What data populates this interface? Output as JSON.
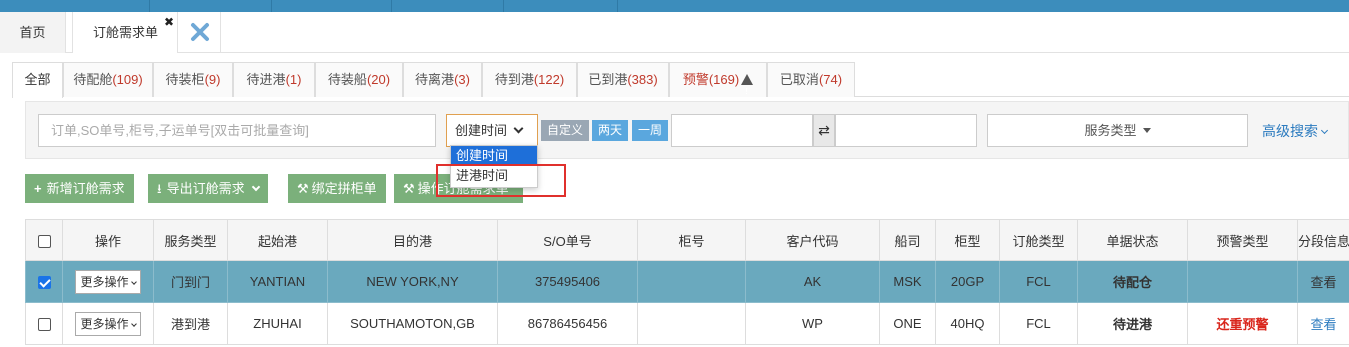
{
  "page_tabs": {
    "home": "首页",
    "order": "订舱需求单",
    "close_mark": "✖"
  },
  "status_tabs": [
    {
      "label": "全部",
      "count": ""
    },
    {
      "label": "待配舱",
      "count": "(109)"
    },
    {
      "label": "待装柜",
      "count": "(9)"
    },
    {
      "label": "待进港",
      "count": "(1)"
    },
    {
      "label": "待装船",
      "count": "(20)"
    },
    {
      "label": "待离港",
      "count": "(3)"
    },
    {
      "label": "待到港",
      "count": "(122)"
    },
    {
      "label": "已到港",
      "count": "(383)"
    },
    {
      "label": "预警",
      "count": "(169)"
    },
    {
      "label": "已取消",
      "count": "(74)"
    }
  ],
  "search": {
    "placeholder": "订单,SO单号,柜号,子运单号[双击可批量查询]",
    "date_type_selected": "创建时间",
    "quick_custom": "自定义",
    "quick_two_days": "两天",
    "quick_week": "一周",
    "service_type": "服务类型",
    "advanced": "高级搜索"
  },
  "dropdown_options": [
    "创建时间",
    "进港时间"
  ],
  "actions": {
    "add": "新增订舱需求",
    "export": "导出订舱需求",
    "bind": "绑定拼柜单",
    "operate": "操作订舱需求单"
  },
  "table": {
    "headers": [
      "",
      "操作",
      "服务类型",
      "起始港",
      "目的港",
      "S/O单号",
      "柜号",
      "客户代码",
      "船司",
      "柜型",
      "订舱类型",
      "单据状态",
      "预警类型",
      "分段信息"
    ],
    "more_ops": "更多操作",
    "rows": [
      {
        "checked": true,
        "service": "门到门",
        "origin": "YANTIAN",
        "dest": "NEW YORK,NY",
        "so": "375495406",
        "container": "",
        "customer": "AK",
        "carrier": "MSK",
        "ctype": "20GP",
        "booking": "FCL",
        "status": "待配仓",
        "alert": "",
        "segment": "查看"
      },
      {
        "checked": false,
        "service": "港到港",
        "origin": "ZHUHAI",
        "dest": "SOUTHAMOTON,GB",
        "so": "86786456456",
        "container": "",
        "customer": "WP",
        "carrier": "ONE",
        "ctype": "40HQ",
        "booking": "FCL",
        "status": "待进港",
        "alert": "还重预警",
        "segment": "查看"
      }
    ]
  },
  "colors": {
    "accent": "#3c8dbc",
    "green_button": "#7bb07b",
    "selected_row": "#6aa9be",
    "alert_red": "#d9261c",
    "link_blue": "#2c7bbf"
  }
}
